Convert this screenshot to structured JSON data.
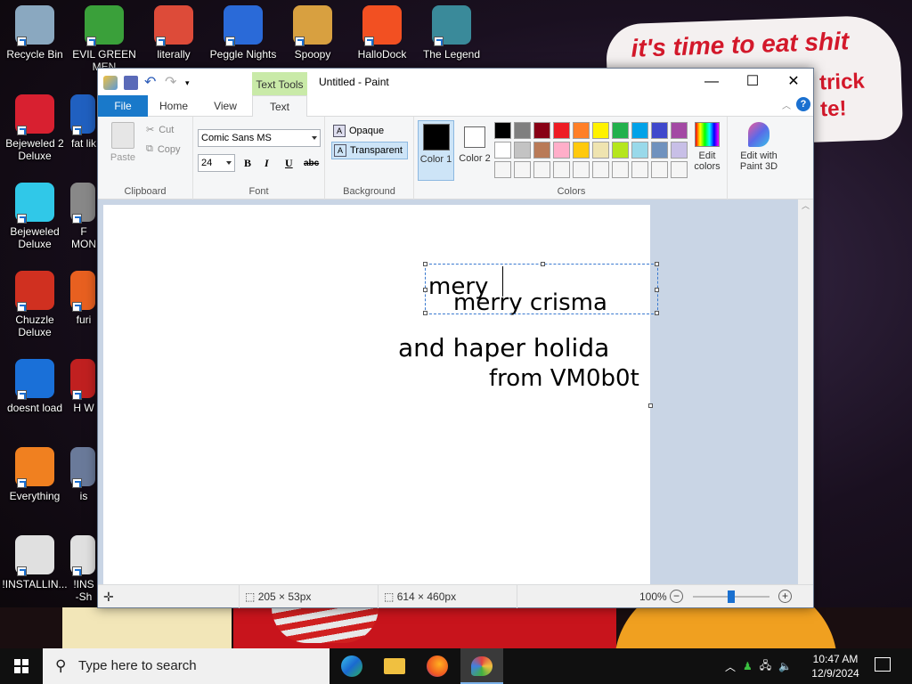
{
  "wallpaper": {
    "caption_line1": "it's time to eat shit",
    "caption_line2": "trick",
    "caption_line3": "te!"
  },
  "desktop_icons": [
    {
      "label": "Recycle Bin",
      "icon": "recycle-bin-icon",
      "color": "#8aa8c0"
    },
    {
      "label": "EVIL GREEN MEN",
      "icon": "green-men-icon",
      "color": "#3aa03a"
    },
    {
      "label": "literally",
      "icon": "chrome-icon",
      "color": "#dd4b39"
    },
    {
      "label": "Peggle Nights",
      "icon": "peggle-icon",
      "color": "#2a6ad8"
    },
    {
      "label": "Spoopy",
      "icon": "spoopy-icon",
      "color": "#d8a040"
    },
    {
      "label": "HalloDock",
      "icon": "windows-logo-icon",
      "color": "#f25022"
    },
    {
      "label": "The Legend",
      "icon": "legend-icon",
      "color": "#3a8a9a"
    },
    {
      "label": "Bejeweled 2 Deluxe",
      "icon": "bejeweled2-icon",
      "color": "#d82030"
    },
    {
      "label": "fat lik",
      "icon": "fatlik-icon",
      "color": "#2060c0"
    },
    {
      "label": "Bejeweled Deluxe",
      "icon": "bejeweled-icon",
      "color": "#30c8e8"
    },
    {
      "label": "F MON",
      "icon": "mon-icon",
      "color": "#888888"
    },
    {
      "label": "Chuzzle Deluxe",
      "icon": "chuzzle-icon",
      "color": "#d03020"
    },
    {
      "label": "furi",
      "icon": "furi-icon",
      "color": "#e86020"
    },
    {
      "label": "doesnt load",
      "icon": "thunderbird-icon",
      "color": "#1a70d8"
    },
    {
      "label": "H W",
      "icon": "hw-icon",
      "color": "#c02020"
    },
    {
      "label": "Everything",
      "icon": "everything-search-icon",
      "color": "#f08020"
    },
    {
      "label": "is",
      "icon": "is-icon",
      "color": "#6a7a9a"
    },
    {
      "label": "!INSTALLIN...",
      "icon": "text-file-icon",
      "color": "#e0e0e0"
    },
    {
      "label": "!INS -Sh",
      "icon": "text-file-icon-2",
      "color": "#e0e0e0"
    }
  ],
  "window": {
    "title": "Untitled - Paint",
    "context_tab": "Text Tools",
    "tabs": [
      "File",
      "Home",
      "View",
      "Text"
    ],
    "clipboard": {
      "paste": "Paste",
      "cut": "Cut",
      "copy": "Copy",
      "label": "Clipboard"
    },
    "font": {
      "family": "Comic Sans MS",
      "size": "24",
      "bold": "B",
      "italic": "I",
      "underline": "U",
      "strike": "abc",
      "label": "Font"
    },
    "background": {
      "opaque": "Opaque",
      "transparent": "Transparent",
      "label": "Background"
    },
    "colors": {
      "color1": "Color 1",
      "color2": "Color 2",
      "label": "Colors",
      "edit_colors": "Edit colors",
      "edit_paint3d": "Edit with Paint 3D",
      "color1_value": "#000000",
      "color2_value": "#ffffff",
      "palette_row1": [
        "#000000",
        "#7f7f7f",
        "#880015",
        "#ed1c24",
        "#ff7f27",
        "#fff200",
        "#22b14c",
        "#00a2e8",
        "#3f48cc",
        "#a349a4"
      ],
      "palette_row2": [
        "#ffffff",
        "#c3c3c3",
        "#b97a57",
        "#ffaec9",
        "#ffc90e",
        "#efe4b0",
        "#b5e61d",
        "#99d9ea",
        "#7092be",
        "#c8bfe7"
      ],
      "palette_row3": [
        "#f5f5f5",
        "#f5f5f5",
        "#f5f5f5",
        "#f5f5f5",
        "#f5f5f5",
        "#f5f5f5",
        "#f5f5f5",
        "#f5f5f5",
        "#f5f5f5",
        "#f5f5f5"
      ]
    },
    "canvas_text": {
      "line_editing": "mery",
      "line1": "merry crisma",
      "line2": "and haper holida",
      "line3": "from VM0b0t"
    },
    "status": {
      "selection_size": "205 × 53px",
      "image_size": "614 × 460px",
      "zoom": "100%"
    }
  },
  "taskbar": {
    "search_placeholder": "Type here to search",
    "time": "10:47 AM",
    "date": "12/9/2024"
  }
}
